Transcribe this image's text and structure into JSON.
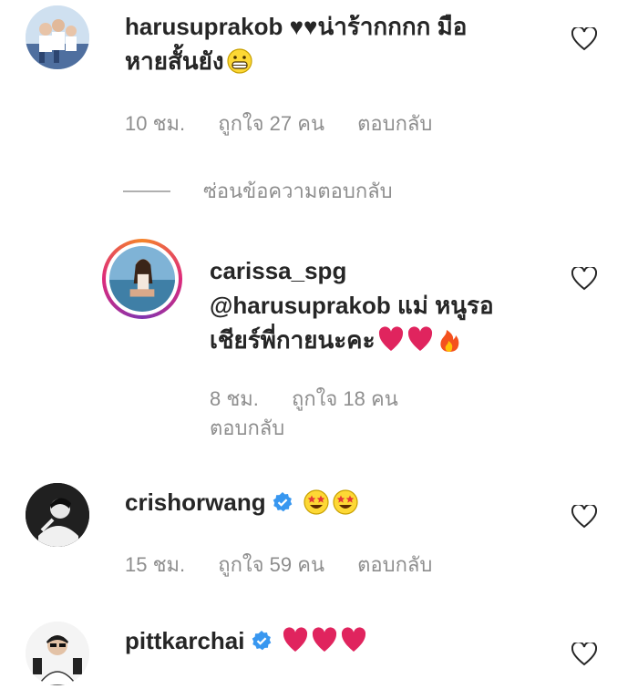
{
  "comments": [
    {
      "username": "harusuprakob",
      "text_line1": "♥♥น่าร้ากกกก มือ",
      "text_line2": "หายสั้นยัง",
      "time": "10 ชม.",
      "likes": "ถูกใจ 27 คน",
      "reply": "ตอบกลับ",
      "emoji": [
        "grinning-face"
      ]
    },
    {
      "username": "carissa_spg",
      "mention": "@harusuprakob",
      "text_line1_rest": " แม่ หนูรอ",
      "text_line2": "เชียร์พี่กายนะคะ",
      "time": "8 ชม.",
      "likes": "ถูกใจ 18 คน",
      "reply": "ตอบกลับ",
      "emoji": [
        "red-heart",
        "red-heart",
        "fire"
      ]
    },
    {
      "username": "crishorwang",
      "verified": true,
      "time": "15 ชม.",
      "likes": "ถูกใจ 59 คน",
      "reply": "ตอบกลับ",
      "emoji": [
        "star-struck",
        "star-struck"
      ]
    },
    {
      "username": "pittkarchai",
      "verified": true,
      "emoji": [
        "red-heart",
        "red-heart",
        "red-heart"
      ]
    }
  ],
  "hide_replies": "ซ่อนข้อความตอบกลับ",
  "colors": {
    "text": "#262626",
    "secondary": "#8e8e8e",
    "verified": "#3897f0",
    "heart_emoji": "#e0245e",
    "story_ring": "#dd2a7b"
  },
  "icons": {
    "like": "heart-outline-icon",
    "verified": "verified-badge-icon"
  }
}
